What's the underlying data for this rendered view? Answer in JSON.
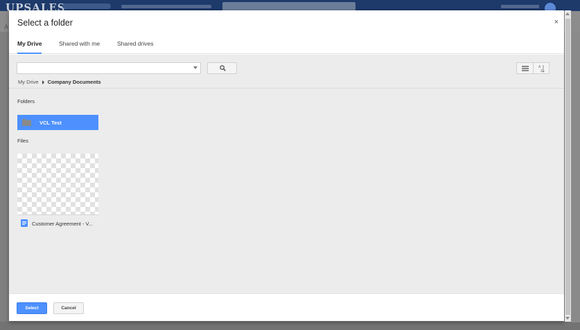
{
  "dialog": {
    "title": "Select a folder",
    "close_label": "×"
  },
  "tabs": [
    {
      "label": "My Drive",
      "active": true
    },
    {
      "label": "Shared with me",
      "active": false
    },
    {
      "label": "Shared drives",
      "active": false
    }
  ],
  "search": {
    "value": "",
    "search_icon": "search-icon"
  },
  "view_controls": {
    "list_icon": "list-view-icon",
    "sort_icon": "sort-az-icon"
  },
  "breadcrumb": {
    "root": "My Drive",
    "current": "Company Documents"
  },
  "sections": {
    "folders_label": "Folders",
    "files_label": "Files"
  },
  "folders": [
    {
      "name": "VCL Test",
      "selected": true,
      "icon": "folder-icon"
    }
  ],
  "files": [
    {
      "name": "Customer Agreement - V...",
      "icon": "google-docs-icon"
    }
  ],
  "footer": {
    "select_label": "Select",
    "cancel_label": "Cancel"
  },
  "colors": {
    "accent": "#4d90fe",
    "dialog_bg": "#ffffff",
    "content_bg": "#ececec"
  }
}
